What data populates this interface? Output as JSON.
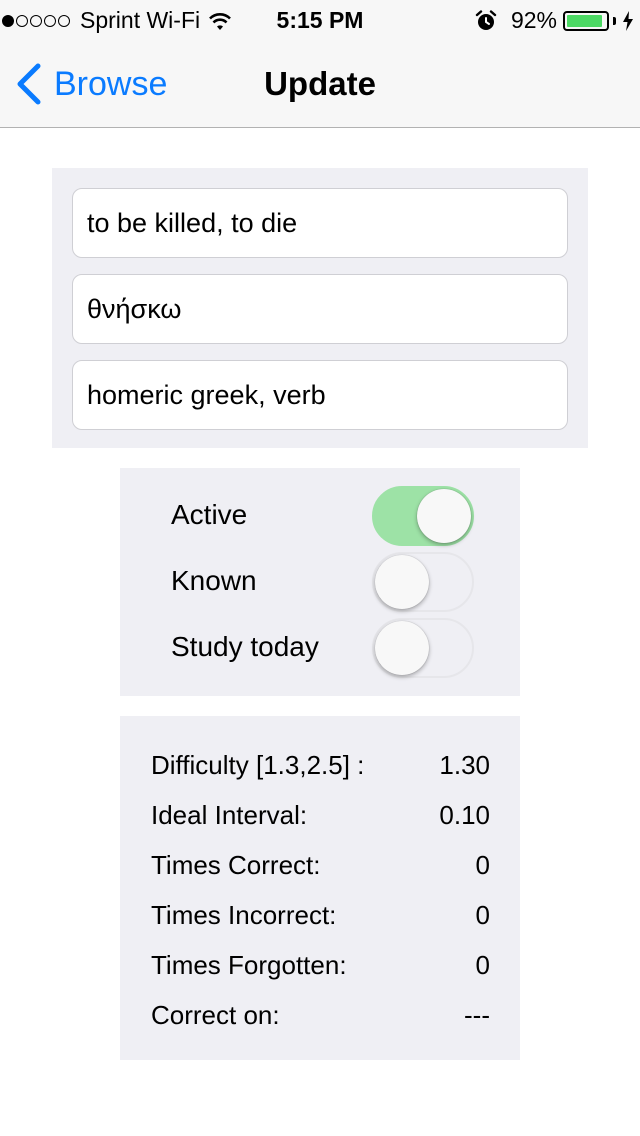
{
  "status_bar": {
    "signal_dots_filled": 1,
    "signal_dots_total": 5,
    "carrier": "Sprint Wi-Fi",
    "time": "5:15 PM",
    "battery_percent": "92%",
    "battery_level": 0.92,
    "battery_color": "#4cd964",
    "icons": [
      "wifi-icon",
      "alarm-icon",
      "battery-icon",
      "charging-bolt-icon"
    ]
  },
  "nav": {
    "back_label": "Browse",
    "title": "Update",
    "accent_color": "#0a7bff"
  },
  "card": {
    "definition": "to be killed, to die",
    "term": "θνήσκω",
    "tags": "homeric greek, verb"
  },
  "toggles": [
    {
      "label": "Active",
      "on": true
    },
    {
      "label": "Known",
      "on": false
    },
    {
      "label": "Study today",
      "on": false
    }
  ],
  "stats": [
    {
      "label": "Difficulty [1.3,2.5] :",
      "value": "1.30"
    },
    {
      "label": "Ideal Interval:",
      "value": "0.10"
    },
    {
      "label": "Times Correct:",
      "value": "0"
    },
    {
      "label": "Times Incorrect:",
      "value": "0"
    },
    {
      "label": "Times Forgotten:",
      "value": "0"
    },
    {
      "label": "Correct on:",
      "value": "---"
    }
  ],
  "colors": {
    "switch_on": "#9de2a6",
    "panel_background": "#efeff4"
  }
}
